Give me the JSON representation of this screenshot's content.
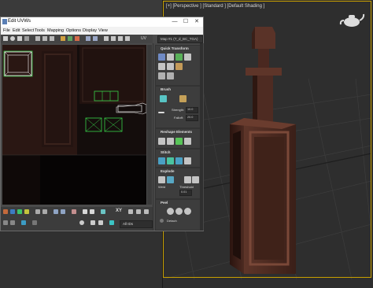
{
  "viewport": {
    "label": "[+] [Perspective ] [Standard ] [Default Shading ]"
  },
  "uvw_window": {
    "title": "Edit UVWs",
    "min_glyph": "—",
    "max_glyph": "☐",
    "close_glyph": "✕",
    "menus": [
      "File",
      "Edit",
      "Select",
      "Tools",
      "Mapping",
      "Options",
      "Display",
      "View"
    ],
    "toolbar_uv_label": "UV",
    "map_dropdown": "Map #1 (T_d_BC_TGA)",
    "xy_label": "XY",
    "ids_dropdown": "All IDs"
  },
  "panel": {
    "quick_transform": {
      "title": "Quick Transform"
    },
    "brush": {
      "title": "Brush",
      "strength_label": "Strength:",
      "strength_value": "10.0",
      "falloff_label": "Falloff:",
      "falloff_value": "20.0"
    },
    "reshape": {
      "title": "Reshape Elements"
    },
    "stitch": {
      "title": "Stitch"
    },
    "explode": {
      "title": "Explode",
      "weld_label": "Weld",
      "threshold_label": "Threshold",
      "threshold_value": "0.01"
    },
    "peel": {
      "title": "Peel",
      "detach_label": "Detach"
    }
  },
  "colors": {
    "viewport_border": "#c8a000",
    "uv_seam_green": "#39d44a",
    "uv_selected_white": "#ffffff",
    "wood_dark": "#3b1f18",
    "wood_mid": "#5a3328"
  }
}
